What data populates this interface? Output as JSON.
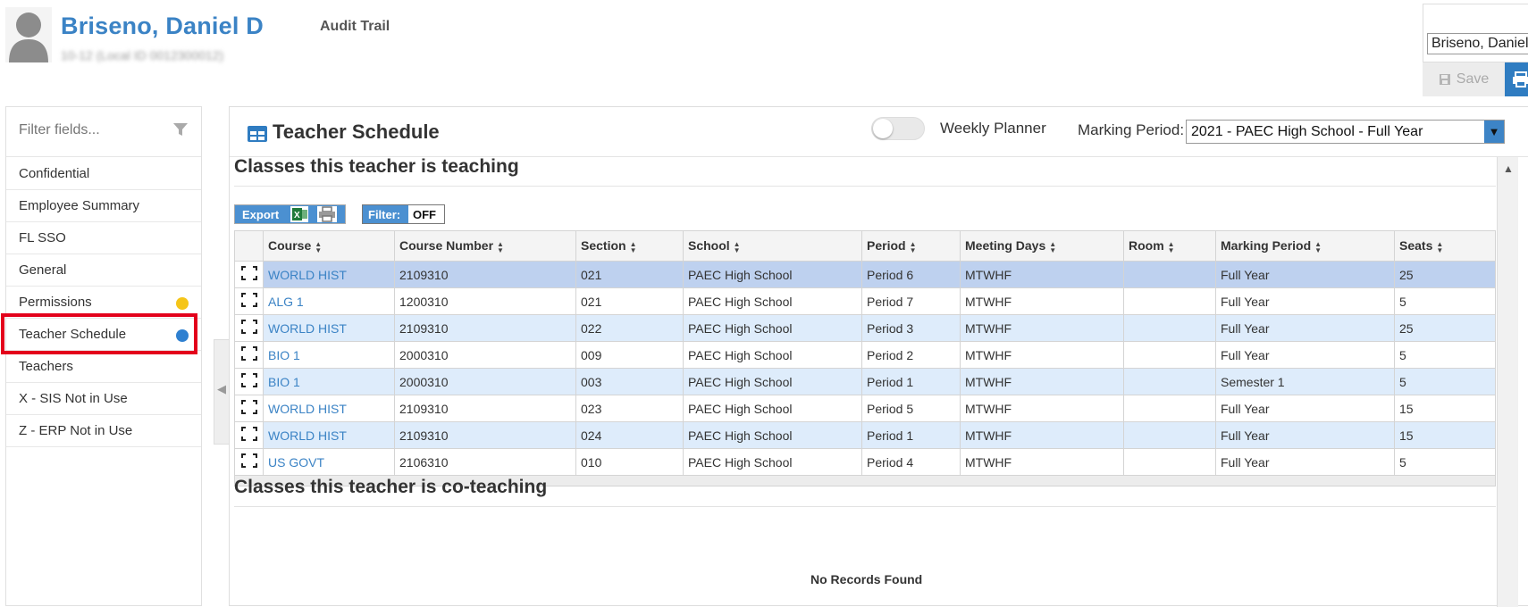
{
  "header": {
    "person_name": "Briseno, Daniel D",
    "person_sub": "10-12 (Local ID 0012300012)",
    "audit_trail": "Audit Trail",
    "search_value": "Briseno, Daniel D",
    "save_label": "Save"
  },
  "sidebar": {
    "filter_placeholder": "Filter fields...",
    "items": [
      {
        "label": "Confidential"
      },
      {
        "label": "Employee Summary"
      },
      {
        "label": "FL SSO"
      },
      {
        "label": "General"
      },
      {
        "label": "Permissions",
        "dot_color": "#f5c518"
      },
      {
        "label": "Teacher Schedule",
        "dot_color": "#2f80d0",
        "selected": true
      },
      {
        "label": "Teachers"
      },
      {
        "label": "X - SIS Not in Use"
      },
      {
        "label": "Z - ERP Not in Use"
      }
    ]
  },
  "panel": {
    "title": "Teacher Schedule",
    "weekly_planner_label": "Weekly Planner",
    "marking_period_label": "Marking Period:",
    "marking_period_value": "2021 - PAEC High School - Full Year",
    "classes_title": "Classes this teacher is teaching",
    "co_teaching_title": "Classes this teacher is co-teaching",
    "no_records": "No Records Found",
    "export_label": "Export",
    "filter_label": "Filter:",
    "filter_state": "OFF"
  },
  "table": {
    "columns": [
      "Course",
      "Course Number",
      "Section",
      "School",
      "Period",
      "Meeting Days",
      "Room",
      "Marking Period",
      "Seats"
    ],
    "rows": [
      [
        "WORLD HIST",
        "2109310",
        "021",
        "PAEC High School",
        "Period 6",
        "MTWHF",
        "",
        "Full Year",
        "25"
      ],
      [
        "ALG 1",
        "1200310",
        "021",
        "PAEC High School",
        "Period 7",
        "MTWHF",
        "",
        "Full Year",
        "5"
      ],
      [
        "WORLD HIST",
        "2109310",
        "022",
        "PAEC High School",
        "Period 3",
        "MTWHF",
        "",
        "Full Year",
        "25"
      ],
      [
        "BIO 1",
        "2000310",
        "009",
        "PAEC High School",
        "Period 2",
        "MTWHF",
        "",
        "Full Year",
        "5"
      ],
      [
        "BIO 1",
        "2000310",
        "003",
        "PAEC High School",
        "Period 1",
        "MTWHF",
        "",
        "Semester 1",
        "5"
      ],
      [
        "WORLD HIST",
        "2109310",
        "023",
        "PAEC High School",
        "Period 5",
        "MTWHF",
        "",
        "Full Year",
        "15"
      ],
      [
        "WORLD HIST",
        "2109310",
        "024",
        "PAEC High School",
        "Period 1",
        "MTWHF",
        "",
        "Full Year",
        "15"
      ],
      [
        "US GOVT",
        "2106310",
        "010",
        "PAEC High School",
        "Period 4",
        "MTWHF",
        "",
        "Full Year",
        "5"
      ]
    ]
  },
  "icons": {
    "avatar": "person-silhouette-icon",
    "filter": "funnel-icon",
    "schedule": "table-grid-icon",
    "save": "floppy-disk-icon",
    "print": "printer-icon",
    "excel": "excel-icon",
    "expand": "expand-icon",
    "collapse": "chevron-left-icon"
  },
  "colors": {
    "accent": "#3b83c5",
    "selected_row": "#bed1ef",
    "alt_row": "#deecfb",
    "highlight_border": "#e3001b"
  }
}
